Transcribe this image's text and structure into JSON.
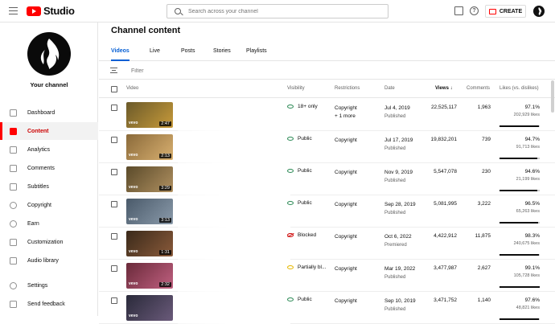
{
  "app": {
    "logo_text": "Studio",
    "search_placeholder": "Search across your channel",
    "create_label": "CREATE"
  },
  "sidebar": {
    "channel_label": "Your channel",
    "items": [
      {
        "label": "Dashboard",
        "icon": "dashboard-icon"
      },
      {
        "label": "Content",
        "icon": "content-icon",
        "active": true
      },
      {
        "label": "Analytics",
        "icon": "analytics-icon"
      },
      {
        "label": "Comments",
        "icon": "comments-icon"
      },
      {
        "label": "Subtitles",
        "icon": "subtitles-icon"
      },
      {
        "label": "Copyright",
        "icon": "copyright-icon"
      },
      {
        "label": "Earn",
        "icon": "earn-icon"
      },
      {
        "label": "Customization",
        "icon": "customization-icon"
      },
      {
        "label": "Audio library",
        "icon": "audio-library-icon"
      },
      {
        "label": "Settings",
        "icon": "settings-icon"
      },
      {
        "label": "Send feedback",
        "icon": "feedback-icon"
      }
    ]
  },
  "main": {
    "title": "Channel content",
    "tabs": [
      "Videos",
      "Live",
      "Posts",
      "Stories",
      "Playlists"
    ],
    "filter_placeholder": "Filter",
    "columns": {
      "video": "Video",
      "visibility": "Visibility",
      "restrictions": "Restrictions",
      "date": "Date",
      "views": "Views",
      "comments": "Comments",
      "likes": "Likes (vs. dislikes)"
    },
    "rows": [
      {
        "duration": "2:47",
        "visibility": "18+ only",
        "vis_color": "green",
        "restrictions": "Copyright",
        "restrictions_extra": "+ 1 more",
        "date": "Jul 4, 2019",
        "status": "Published",
        "views": "22,525,117",
        "comments": "1,963",
        "likes_pct": "97.1%",
        "likes_count": "202,929 likes",
        "likes_frac": 0.971,
        "thumb": [
          "#6b5a2a",
          "#c79a3a"
        ]
      },
      {
        "duration": "2:13",
        "visibility": "Public",
        "vis_color": "green",
        "restrictions": "Copyright",
        "restrictions_extra": "",
        "date": "Jul 17, 2019",
        "status": "Published",
        "views": "19,832,201",
        "comments": "739",
        "likes_pct": "94.7%",
        "likes_count": "91,713 likes",
        "likes_frac": 0.947,
        "thumb": [
          "#8a6a3a",
          "#d9b070"
        ]
      },
      {
        "duration": "3:29",
        "visibility": "Public",
        "vis_color": "green",
        "restrictions": "Copyright",
        "restrictions_extra": "",
        "date": "Nov 9, 2019",
        "status": "Published",
        "views": "5,547,078",
        "comments": "230",
        "likes_pct": "94.6%",
        "likes_count": "21,199 likes",
        "likes_frac": 0.946,
        "thumb": [
          "#5a4a2a",
          "#b09060"
        ]
      },
      {
        "duration": "3:13",
        "visibility": "Public",
        "vis_color": "green",
        "restrictions": "Copyright",
        "restrictions_extra": "",
        "date": "Sep 28, 2019",
        "status": "Published",
        "views": "5,081,995",
        "comments": "3,222",
        "likes_pct": "96.5%",
        "likes_count": "65,263 likes",
        "likes_frac": 0.965,
        "thumb": [
          "#4a5a6a",
          "#8a9aaa"
        ]
      },
      {
        "duration": "1:31",
        "visibility": "Blocked",
        "vis_color": "red",
        "restrictions": "Copyright",
        "restrictions_extra": "",
        "date": "Oct 6, 2022",
        "status": "Premiered",
        "views": "4,422,912",
        "comments": "11,875",
        "likes_pct": "98.3%",
        "likes_count": "240,675 likes",
        "likes_frac": 0.983,
        "thumb": [
          "#3a2a1a",
          "#8a5a3a"
        ]
      },
      {
        "duration": "2:32",
        "visibility": "Partially bl...",
        "vis_color": "yellow",
        "restrictions": "Copyright",
        "restrictions_extra": "",
        "date": "Mar 19, 2022",
        "status": "Published",
        "views": "3,477,987",
        "comments": "2,627",
        "likes_pct": "99.1%",
        "likes_count": "105,728 likes",
        "likes_frac": 0.991,
        "thumb": [
          "#6a2a3a",
          "#c06080"
        ]
      },
      {
        "duration": "",
        "visibility": "Public",
        "vis_color": "green",
        "restrictions": "Copyright",
        "restrictions_extra": "",
        "date": "Sep 10, 2019",
        "status": "Published",
        "views": "3,471,752",
        "comments": "1,140",
        "likes_pct": "97.6%",
        "likes_count": "48,821 likes",
        "likes_frac": 0.976,
        "thumb": [
          "#2a2a3a",
          "#6a5a7a"
        ]
      }
    ]
  }
}
